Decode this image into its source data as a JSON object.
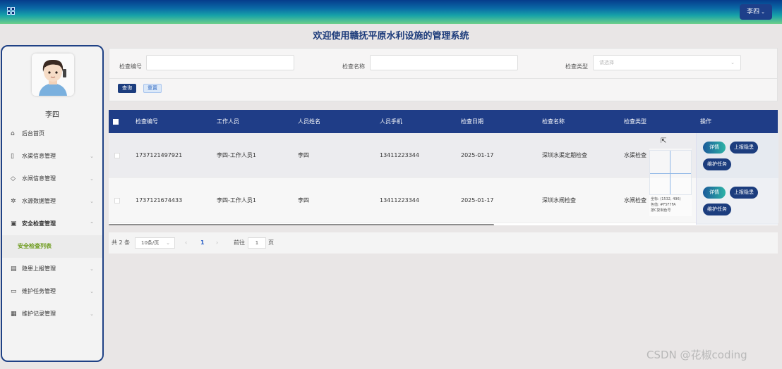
{
  "header": {
    "menu_icon": "grid-icon",
    "user": "李四",
    "user_caret": "⌄"
  },
  "page_title": "欢迎使用赣抚平原水利设施的管理系统",
  "sidebar": {
    "username": "李四",
    "items": [
      {
        "label": "后台首页",
        "icon": "home-icon",
        "glyph": "⌂",
        "arrow": ""
      },
      {
        "label": "水渠信息管理",
        "icon": "bookmark-icon",
        "glyph": "▯",
        "arrow": "⌄"
      },
      {
        "label": "水闸信息管理",
        "icon": "tag-icon",
        "glyph": "◇",
        "arrow": "⌄"
      },
      {
        "label": "水源数据管理",
        "icon": "gear-icon",
        "glyph": "✲",
        "arrow": "⌄"
      },
      {
        "label": "安全检查管理",
        "icon": "inbox-icon",
        "glyph": "▣",
        "arrow": "⌃"
      },
      {
        "label": "安全检查列表",
        "icon": "",
        "glyph": "",
        "arrow": ""
      },
      {
        "label": "隐患上报管理",
        "icon": "clipboard-icon",
        "glyph": "▤",
        "arrow": "⌄"
      },
      {
        "label": "维护任务管理",
        "icon": "message-icon",
        "glyph": "▭",
        "arrow": "⌄"
      },
      {
        "label": "维护记录管理",
        "icon": "calendar-icon",
        "glyph": "▦",
        "arrow": "⌄"
      }
    ]
  },
  "search": {
    "code_label": "检查编号",
    "name_label": "检查名称",
    "type_label": "检查类型",
    "type_placeholder": "请选择",
    "dropdown_glyph": "⌄",
    "query_button": "查询",
    "reset_button": "重置"
  },
  "table": {
    "columns": [
      "检查编号",
      "工作人员",
      "人员姓名",
      "人员手机",
      "检查日期",
      "检查名称",
      "检查类型",
      "操作"
    ],
    "rows": [
      {
        "code": "1737121497921",
        "worker": "李四-工作人员1",
        "name": "李四",
        "phone": "13411223344",
        "date": "2025-01-17",
        "check_name": "深圳水渠定期检查",
        "check_type": "水渠检查"
      },
      {
        "code": "1737121674433",
        "worker": "李四-工作人员1",
        "name": "李四",
        "phone": "13411223344",
        "date": "2025-01-17",
        "check_name": "深圳水闸检查",
        "check_type": "水闸检查"
      }
    ],
    "actions": {
      "detail": "详情",
      "report": "上报隐患",
      "task": "维护任务"
    }
  },
  "color_picker": {
    "coord": "坐标: (1532, 496)",
    "color": "色值: #F5F7FA",
    "hint": "按C复制色号"
  },
  "cursor_glyph": "⇱",
  "pagination": {
    "total": "共 2 条",
    "page_size": "10条/页",
    "page_size_caret": "⌄",
    "prev": "‹",
    "current_page": "1",
    "next": "›",
    "goto_label": "前往",
    "goto_value": "1",
    "page_suffix": "页"
  },
  "watermark": "CSDN @花椒coding"
}
